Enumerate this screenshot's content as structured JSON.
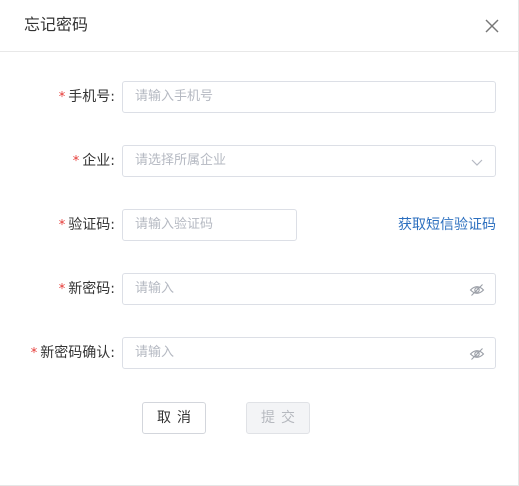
{
  "dialog": {
    "title": "忘记密码",
    "close_icon": "close-icon"
  },
  "form": {
    "required_mark": "*",
    "phone": {
      "label": "手机号:",
      "placeholder": "请输入手机号"
    },
    "company": {
      "label": "企业:",
      "placeholder": "请选择所属企业",
      "icon": "chevron-down-icon"
    },
    "code": {
      "label": "验证码:",
      "placeholder": "请输入验证码",
      "link": "获取短信验证码"
    },
    "new_password": {
      "label": "新密码:",
      "placeholder": "请输入",
      "icon": "eye-slash-icon"
    },
    "confirm_password": {
      "label": "新密码确认:",
      "placeholder": "请输入",
      "icon": "eye-slash-icon"
    }
  },
  "buttons": {
    "cancel": "取消",
    "submit": "提交"
  },
  "colors": {
    "required": "#e53935",
    "link": "#2c6fbf",
    "placeholder": "#b5b9c2",
    "border": "#dcdfe6"
  }
}
